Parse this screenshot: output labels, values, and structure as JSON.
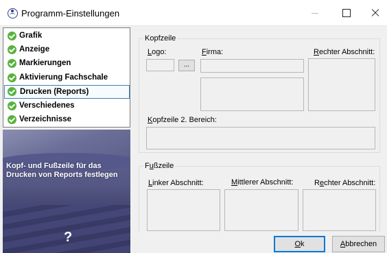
{
  "window": {
    "title": "Programm-Einstellungen"
  },
  "nav": {
    "items": [
      {
        "label": "Grafik",
        "selected": false
      },
      {
        "label": "Anzeige",
        "selected": false
      },
      {
        "label": "Markierungen",
        "selected": false
      },
      {
        "label": "Aktivierung Fachschale",
        "selected": false
      },
      {
        "label": "Drucken (Reports)",
        "selected": true
      },
      {
        "label": "Verschiedenes",
        "selected": false
      },
      {
        "label": "Verzeichnisse",
        "selected": false
      }
    ]
  },
  "help": {
    "text": "Kopf- und Fußzeile für das Drucken von Reports festlegen",
    "icon": "?"
  },
  "kopfzeile": {
    "legend": "Kopfzeile",
    "logo_label_u": "L",
    "logo_label_rest": "ogo:",
    "browse_label": "...",
    "firma_label_u": "F",
    "firma_label_rest": "irma:",
    "rechter_label_u": "R",
    "rechter_label_rest": "echter Abschnitt:",
    "bereich2_label_u": "K",
    "bereich2_label_rest": "opfzeile 2. Bereich:"
  },
  "fusszeile": {
    "legend_pre": "F",
    "legend_u": "u",
    "legend_post": "ßzeile",
    "linker_label_u": "L",
    "linker_label_rest": "inker Abschnitt:",
    "mittlerer_label_u": "M",
    "mittlerer_label_rest": "ittlerer Abschnitt:",
    "rechter_label_pre": "R",
    "rechter_label_u": "e",
    "rechter_label_post": "chter Abschnitt:"
  },
  "buttons": {
    "ok_u": "O",
    "ok_rest": "k",
    "cancel_u": "A",
    "cancel_rest": "bbrechen"
  },
  "colors": {
    "check": "#58b23e",
    "selection_border": "#3c7fb1",
    "default_button_border": "#0078d7"
  }
}
